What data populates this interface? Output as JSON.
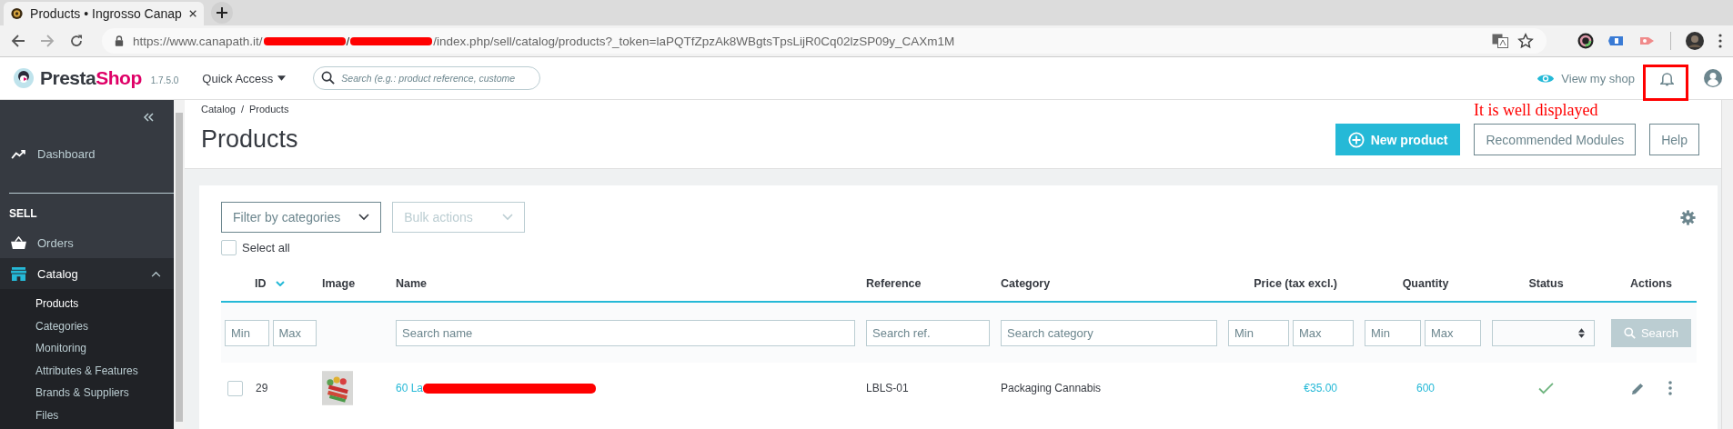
{
  "browser": {
    "tab": {
      "title": "Products • Ingrosso Canap"
    },
    "url_parts": [
      {
        "kind": "text",
        "text": "https://www.canapath.it/"
      },
      {
        "kind": "redaction"
      },
      {
        "kind": "text",
        "text": "/"
      },
      {
        "kind": "redaction"
      },
      {
        "kind": "text",
        "text": "/index.php/sell/catalog/products?_token=laPQTfZpzAk8WBgtsTpsLijR0Cq02lzSP09y_CAXm1M"
      }
    ]
  },
  "header": {
    "logo": [
      "Presta",
      "Shop"
    ],
    "version": "1.7.5.0",
    "quick_access": "Quick Access",
    "search": {
      "placeholder": "Search (e.g.: product reference, custome"
    },
    "view_shop": "View my shop"
  },
  "annotation": {
    "text": "It is well displayed",
    "highlight": true
  },
  "sidebar": {
    "items": [
      {
        "kind": "link",
        "label": "Dashboard",
        "selected": false
      },
      {
        "kind": "section",
        "label": "SELL"
      },
      {
        "kind": "link",
        "label": "Orders",
        "selected": false
      },
      {
        "kind": "link",
        "label": "Catalog",
        "selected": true,
        "expanded": true,
        "children": [
          {
            "label": "Products",
            "selected": true
          },
          {
            "label": "Categories",
            "selected": false
          },
          {
            "label": "Monitoring",
            "selected": false
          },
          {
            "label": "Attributes & Features",
            "selected": false
          },
          {
            "label": "Brands & Suppliers",
            "selected": false
          },
          {
            "label": "Files",
            "selected": false
          }
        ]
      }
    ]
  },
  "page": {
    "breadcrumb": {
      "items": [
        "Catalog",
        "Products"
      ],
      "separator": "/"
    },
    "title": "Products",
    "buttons": [
      {
        "label": "New product",
        "kind": "primary"
      },
      {
        "label": "Recommended Modules",
        "kind": "outline"
      },
      {
        "label": "Help",
        "kind": "outline"
      }
    ]
  },
  "toolbar": {
    "filter": "Filter by categories",
    "bulk": {
      "label": "Bulk actions",
      "disabled": true
    },
    "select_all": {
      "label": "Select all",
      "checked": false
    }
  },
  "table": {
    "columns": [
      {
        "label": "ID",
        "sorted": true
      },
      {
        "label": "Image",
        "sorted": false
      },
      {
        "label": "Name",
        "sorted": false
      },
      {
        "label": "Reference",
        "sorted": false
      },
      {
        "label": "Category",
        "sorted": false
      },
      {
        "label": "Price (tax excl.)",
        "sorted": false
      },
      {
        "label": "Quantity",
        "sorted": false
      },
      {
        "label": "Status",
        "sorted": false
      },
      {
        "label": "Actions",
        "sorted": false
      }
    ],
    "filters": [
      {
        "kind": "range",
        "fields": [
          {
            "placeholder": "Min"
          },
          {
            "placeholder": "Max"
          }
        ]
      },
      {
        "kind": "none"
      },
      {
        "kind": "text",
        "placeholder": "Search name"
      },
      {
        "kind": "text",
        "placeholder": "Search ref."
      },
      {
        "kind": "text",
        "placeholder": "Search category"
      },
      {
        "kind": "range",
        "fields": [
          {
            "placeholder": "Min"
          },
          {
            "placeholder": "Max"
          }
        ]
      },
      {
        "kind": "range",
        "fields": [
          {
            "placeholder": "Min"
          },
          {
            "placeholder": "Max"
          }
        ]
      },
      {
        "kind": "select"
      },
      {
        "kind": "button",
        "label": "Search"
      }
    ],
    "rows": [
      {
        "selected": false,
        "id": "29",
        "name": "60 La",
        "name_redacted": true,
        "reference": "LBLS-01",
        "category": "Packaging Cannabis",
        "price": "€35.00",
        "quantity": "600",
        "status": true
      }
    ]
  }
}
